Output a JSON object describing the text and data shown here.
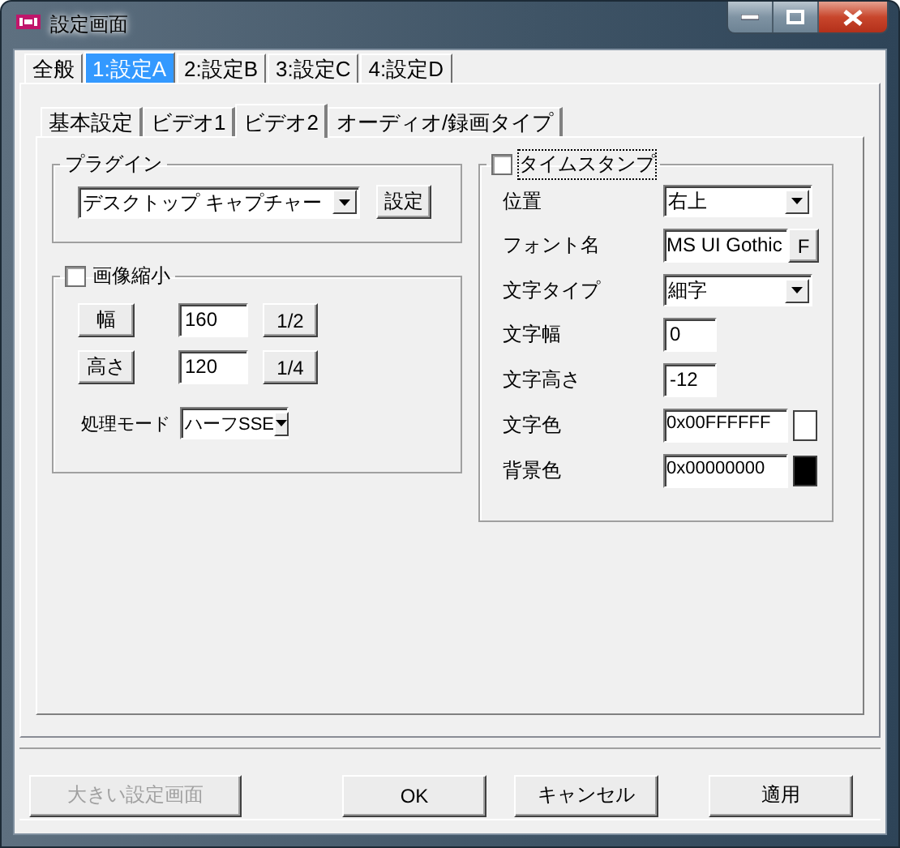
{
  "window": {
    "title": "設定画面"
  },
  "tabs": [
    {
      "label": "全般",
      "selected": false
    },
    {
      "label": "1:設定A",
      "selected": true
    },
    {
      "label": "2:設定B",
      "selected": false
    },
    {
      "label": "3:設定C",
      "selected": false
    },
    {
      "label": "4:設定D",
      "selected": false
    }
  ],
  "subtabs": [
    {
      "label": "基本設定",
      "selected": false
    },
    {
      "label": "ビデオ1",
      "selected": false
    },
    {
      "label": "ビデオ2",
      "selected": true
    },
    {
      "label": "オーディオ/録画タイプ",
      "selected": false
    }
  ],
  "plugin_group": {
    "title": "プラグイン",
    "plugin": "デスクトップ キャプチャー",
    "button": "設定"
  },
  "resize_group": {
    "title": "画像縮小",
    "checked": false,
    "rows": [
      {
        "button": "幅",
        "value": "160",
        "ratio": "1/2"
      },
      {
        "button": "高さ",
        "value": "120",
        "ratio": "1/4"
      }
    ],
    "mode_label": "処理モード",
    "mode": "ハーフSSE"
  },
  "timestamp_group": {
    "title": "タイムスタンプ",
    "checked": false,
    "focused": true,
    "fields": [
      {
        "kind": "select",
        "label": "位置",
        "value": "右上"
      },
      {
        "kind": "font",
        "label": "フォント名",
        "value": "MS UI Gothic",
        "button": "F"
      },
      {
        "kind": "select",
        "label": "文字タイプ",
        "value": "細字"
      },
      {
        "kind": "text",
        "label": "文字幅",
        "value": "0"
      },
      {
        "kind": "text",
        "label": "文字高さ",
        "value": "-12"
      },
      {
        "kind": "color",
        "label": "文字色",
        "value": "0x00FFFFFF",
        "color": "#ffffff"
      },
      {
        "kind": "color",
        "label": "背景色",
        "value": "0x00000000",
        "color": "#000000"
      }
    ]
  },
  "footer_buttons": [
    {
      "label": "大きい設定画面",
      "disabled": true
    },
    {
      "label": "OK",
      "disabled": false
    },
    {
      "label": "キャンセル",
      "disabled": false
    },
    {
      "label": "適用",
      "disabled": false
    }
  ]
}
